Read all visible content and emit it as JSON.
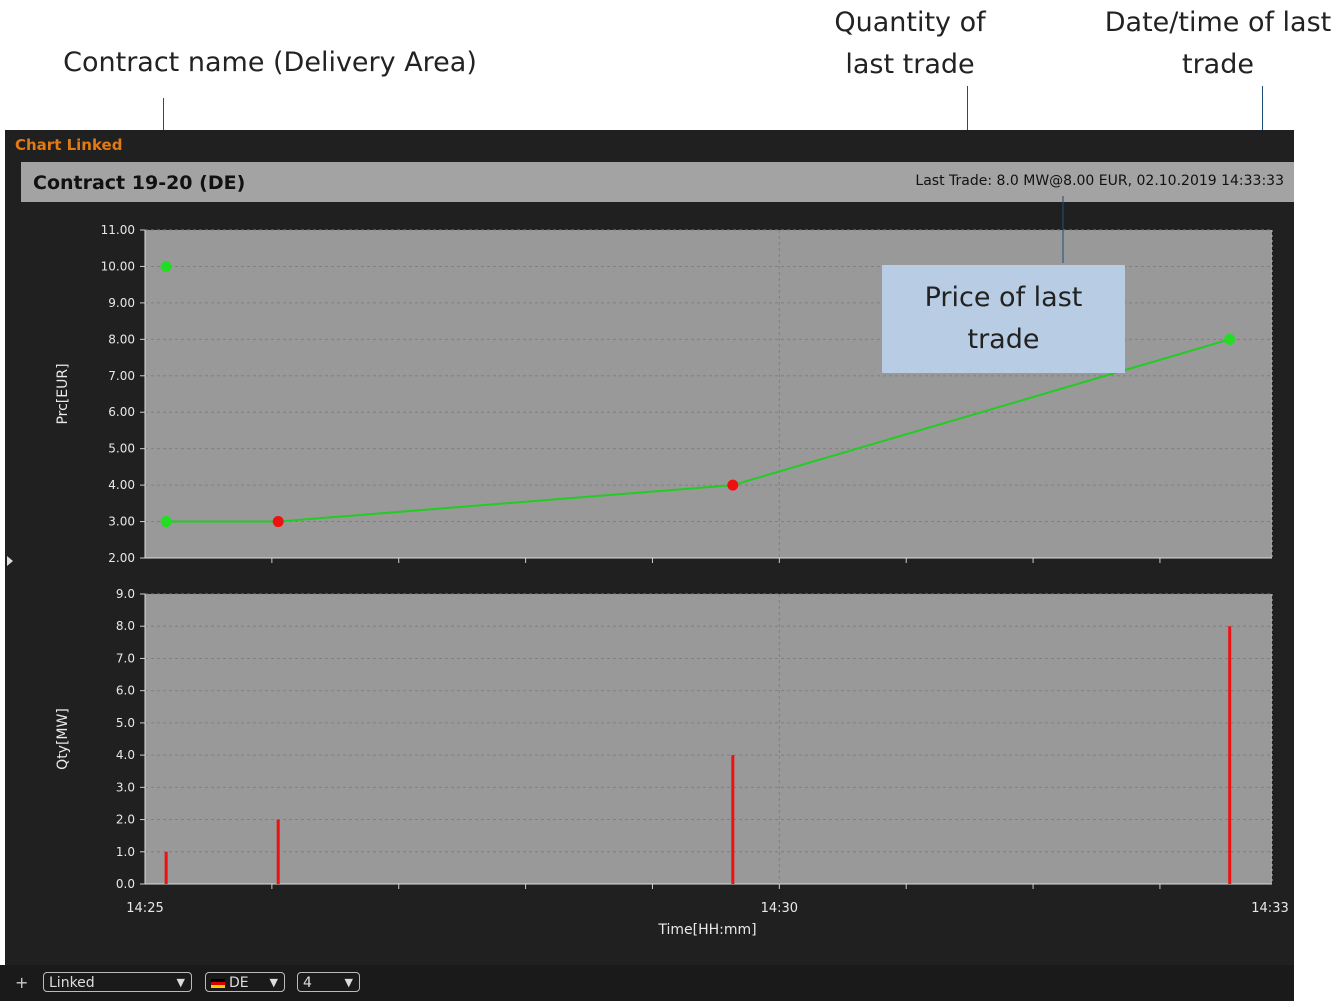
{
  "annotations": {
    "contract": "Contract name (Delivery Area)",
    "quantity_line1": "Quantity of",
    "quantity_line2": "last trade",
    "datetime_line1": "Date/time of last",
    "datetime_line2": "trade",
    "price_line1": "Price of last",
    "price_line2": "trade"
  },
  "window": {
    "title": "Chart Linked"
  },
  "header": {
    "contract": "Contract 19-20 (DE)",
    "last_trade": "Last Trade: 8.0 MW@8.00 EUR, 02.10.2019 14:33:33"
  },
  "toolbar": {
    "plus": "+",
    "mode": "Linked",
    "area": "DE",
    "count": "4"
  },
  "colors": {
    "app_bg": "#202020",
    "plot_bg": "#999999",
    "price_line": "#22cc22",
    "buy_marker": "#22dd22",
    "sell_marker": "#ee1111",
    "volume_bar": "#ee1111",
    "title_accent": "#e07a14"
  },
  "chart_data": [
    {
      "type": "line",
      "title": "",
      "xlabel": "",
      "ylabel": "Prc[EUR]",
      "ylim": [
        2.0,
        11.0
      ],
      "yticks": [
        "11.00",
        "10.00",
        "9.00",
        "8.00",
        "7.00",
        "6.00",
        "5.00",
        "4.00",
        "3.00",
        "2.00"
      ],
      "grid": true,
      "series": [
        {
          "values": [
            {
              "x": "14:25:10",
              "y": 3.0,
              "side": "buy"
            },
            {
              "x": "14:26:03",
              "y": 3.0,
              "side": "sell"
            },
            {
              "x": "14:29:38",
              "y": 4.0,
              "side": "sell"
            },
            {
              "x": "14:33:33",
              "y": 8.0,
              "side": "buy"
            }
          ]
        }
      ],
      "markers": [
        {
          "x": "14:25:10",
          "y": 10.0,
          "side": "buy"
        }
      ]
    },
    {
      "type": "bar",
      "title": "",
      "xlabel": "Time[HH:mm]",
      "ylabel": "Qty[MW]",
      "ylim": [
        0.0,
        9.0
      ],
      "yticks": [
        "9.0",
        "8.0",
        "7.0",
        "6.0",
        "5.0",
        "4.0",
        "3.0",
        "2.0",
        "1.0",
        "0.0"
      ],
      "xticks": [
        "14:25",
        "14:30",
        "14:33"
      ],
      "x_range": [
        "14:25:00",
        "14:33:53"
      ],
      "grid": true,
      "values": [
        {
          "x": "14:25:10",
          "y": 1.0
        },
        {
          "x": "14:26:03",
          "y": 2.0
        },
        {
          "x": "14:29:38",
          "y": 4.0
        },
        {
          "x": "14:33:33",
          "y": 8.0
        }
      ]
    }
  ]
}
